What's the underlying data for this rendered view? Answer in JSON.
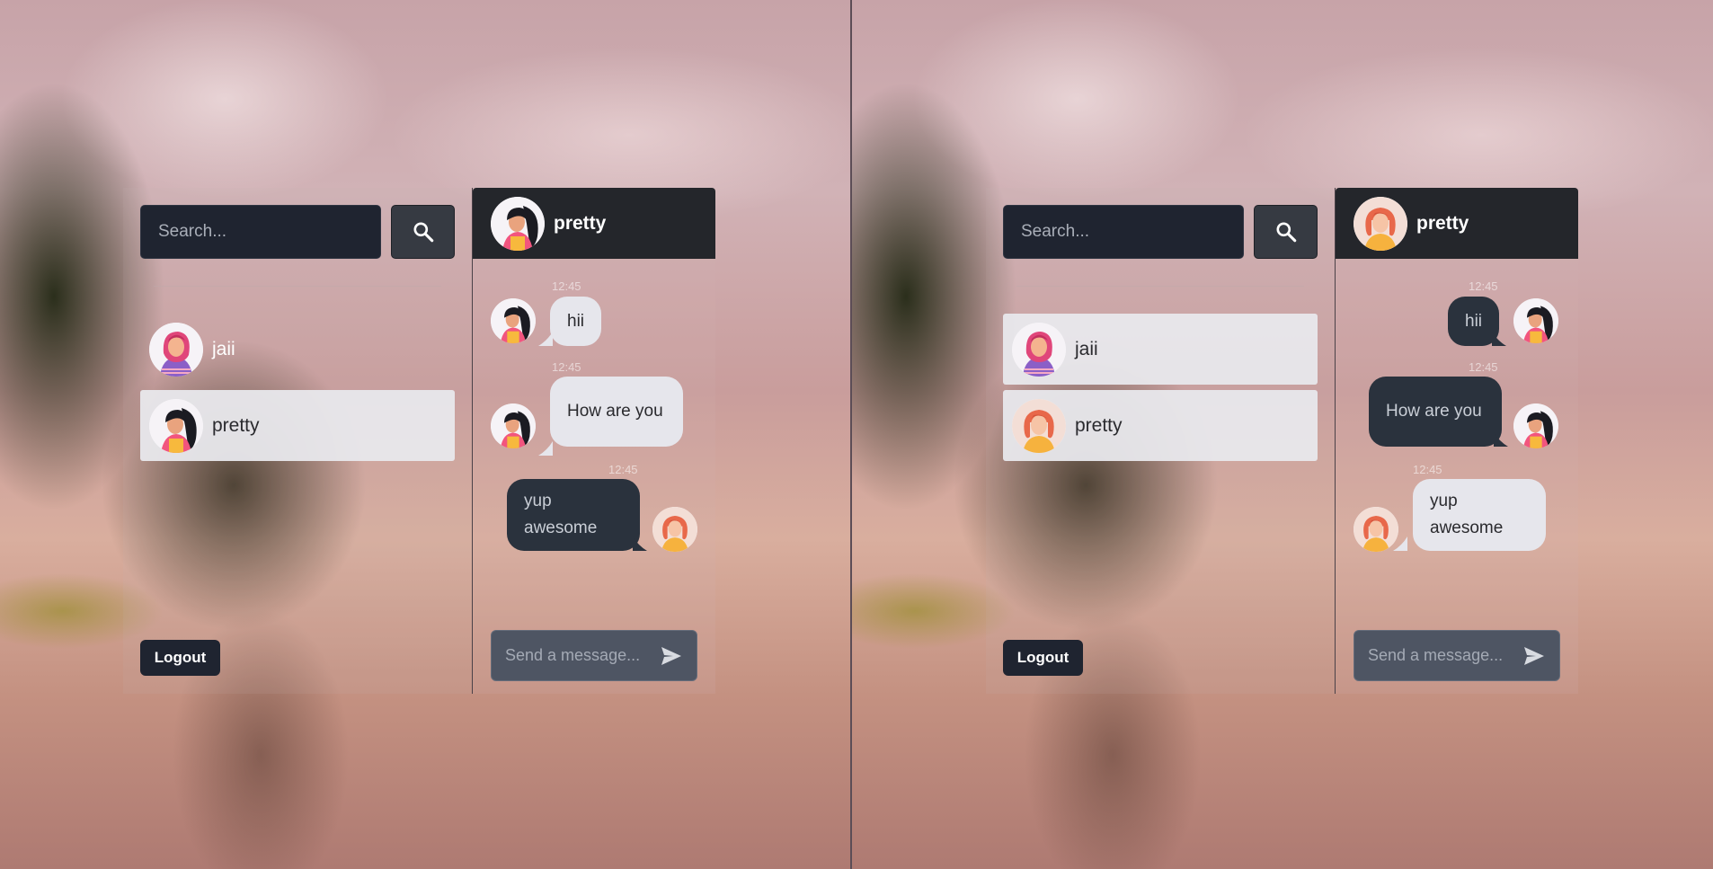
{
  "colors": {
    "panel_dark": "#24262b",
    "search_bg": "#1f2430",
    "bubble_light": "#e6e6ec",
    "bubble_dark": "#2a323d",
    "selected_row": "#e8e8ec"
  },
  "icons": {
    "search": "magnifier",
    "send": "paper-plane",
    "avatar_jaii": "woman-pink-hijab",
    "avatar_pretty_dark": "woman-black-hair",
    "avatar_pretty_red": "woman-red-hair"
  },
  "left": {
    "search": {
      "placeholder": "Search..."
    },
    "users": [
      {
        "name": "jaii"
      },
      {
        "name": "pretty"
      }
    ],
    "logout_label": "Logout",
    "chat": {
      "title": "pretty",
      "messages": [
        {
          "text": "hii",
          "time": "12:45"
        },
        {
          "text": "How are you",
          "time": "12:45"
        },
        {
          "text": "yup awesome",
          "time": "12:45"
        }
      ],
      "composer_placeholder": "Send a message..."
    }
  },
  "right": {
    "search": {
      "placeholder": "Search..."
    },
    "users": [
      {
        "name": "jaii"
      },
      {
        "name": "pretty"
      }
    ],
    "logout_label": "Logout",
    "chat": {
      "title": "pretty",
      "messages": [
        {
          "text": "hii",
          "time": "12:45"
        },
        {
          "text": "How are you",
          "time": "12:45"
        },
        {
          "text": "yup awesome",
          "time": "12:45"
        }
      ],
      "composer_placeholder": "Send a message..."
    }
  }
}
